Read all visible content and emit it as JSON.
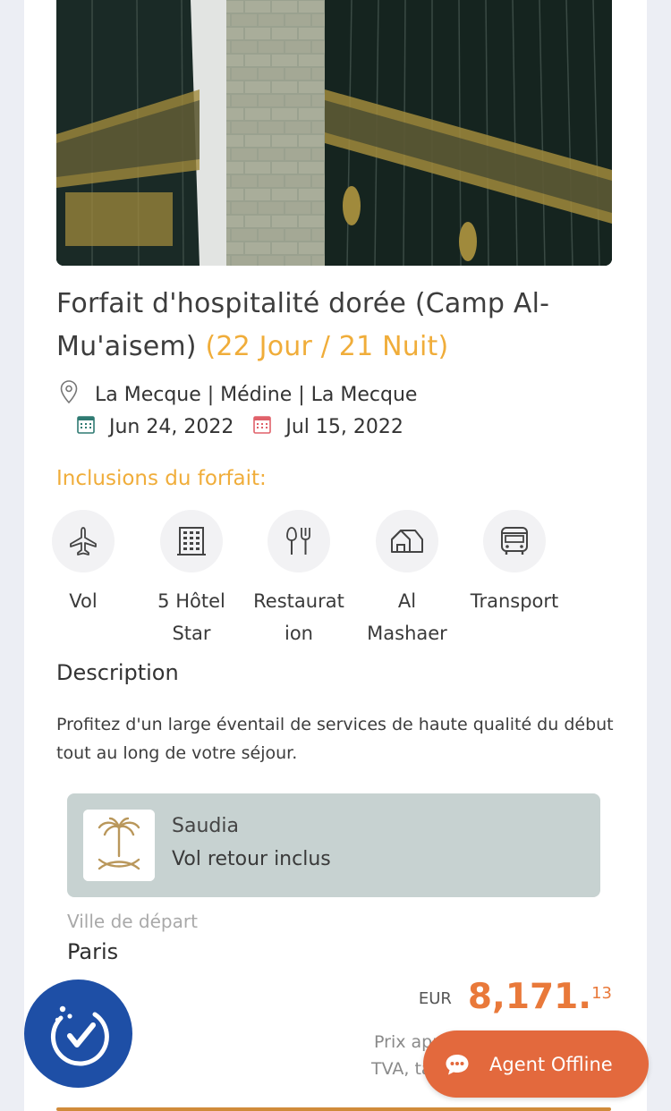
{
  "package": {
    "title": "Forfait d'hospitalité dorée (Camp Al-Mu'aisem)",
    "duration": "(22 Jour / 21 Nuit)",
    "route": "La Mecque | Médine | La Mecque",
    "start_date": "Jun 24, 2022",
    "end_date": "Jul 15, 2022"
  },
  "inclusions": {
    "heading": "Inclusions du forfait:",
    "items": [
      {
        "label_line1": "Vol",
        "label_line2": "",
        "icon": "plane-icon"
      },
      {
        "label_line1": "5 Hôtel",
        "label_line2": "Star",
        "icon": "hotel-building-icon"
      },
      {
        "label_line1": "Restaurat",
        "label_line2": "ion",
        "icon": "fork-knife-icon"
      },
      {
        "label_line1": "Al",
        "label_line2": "Mashaer",
        "icon": "tent-icon"
      },
      {
        "label_line1": "Transport",
        "label_line2": "",
        "icon": "bus-icon"
      }
    ]
  },
  "description": {
    "heading": "Description",
    "text": "Profitez d'un large éventail de services de haute qualité du début tout au long de votre séjour."
  },
  "airline": {
    "name": "Saudia",
    "subtitle": "Vol retour inclus"
  },
  "departure": {
    "label": "Ville de départ",
    "city": "Paris"
  },
  "price": {
    "currency": "EUR",
    "amount": "8,171.",
    "decimals": "13",
    "note_line1": "Prix applicab",
    "note_line2": "TVA, taxes et"
  },
  "agent_button": {
    "label": "Agent Offline"
  },
  "colors": {
    "accent": "#f0ad3a",
    "price": "#e9793a",
    "agent": "#e3693d",
    "a11y": "#1e4fa6"
  }
}
